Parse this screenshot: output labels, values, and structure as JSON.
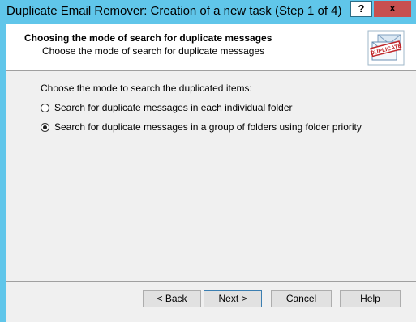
{
  "window": {
    "title": "Duplicate Email Remover: Creation of a new task (Step 1 of 4)",
    "help_label": "?",
    "close_label": "x",
    "accent_color": "#60c6ea",
    "close_color": "#c7504f"
  },
  "header": {
    "title": "Choosing the mode of search for duplicate messages",
    "subtitle": "Choose the mode of search for duplicate messages",
    "logo_icon": "duplicate-envelope-icon",
    "logo_text": "DUPLICATE"
  },
  "main": {
    "prompt": "Choose the mode to search the duplicated items:",
    "options": [
      {
        "label": "Search for duplicate messages in each individual folder",
        "checked": false
      },
      {
        "label": "Search for duplicate messages in a group of folders using folder priority",
        "checked": true
      }
    ]
  },
  "buttons": {
    "back": "< Back",
    "next": "Next >",
    "cancel": "Cancel",
    "help": "Help"
  }
}
